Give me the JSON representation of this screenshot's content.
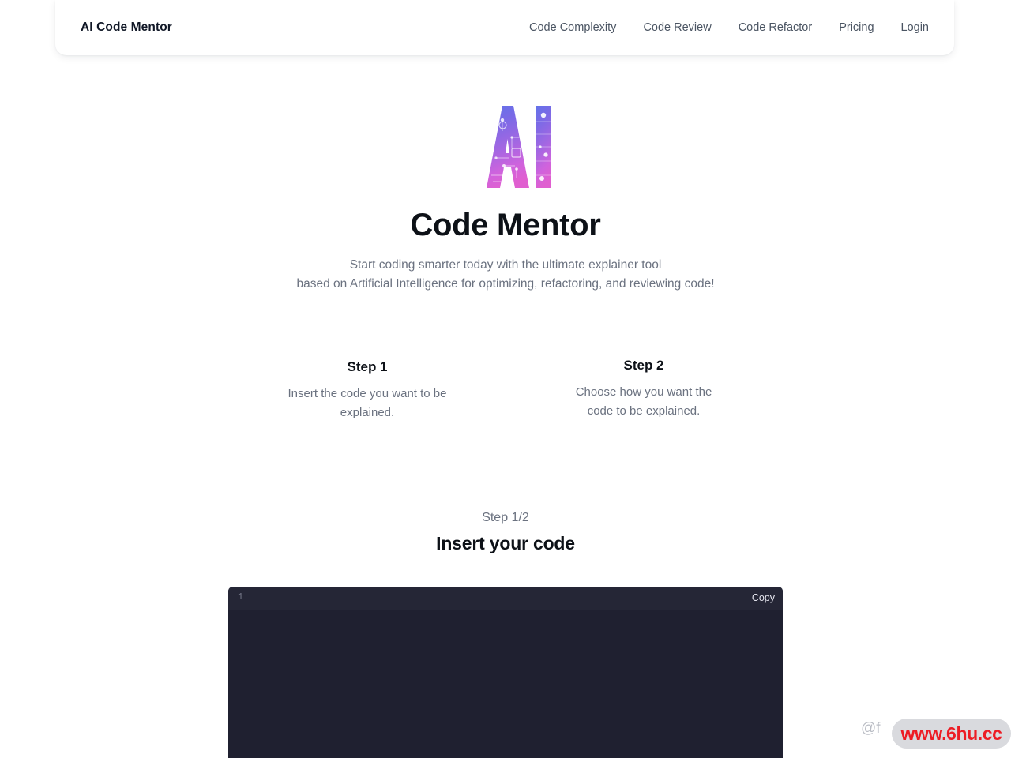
{
  "header": {
    "brand": "AI Code Mentor",
    "nav": [
      {
        "label": "Code Complexity",
        "name": "nav-code-complexity"
      },
      {
        "label": "Code Review",
        "name": "nav-code-review"
      },
      {
        "label": "Code Refactor",
        "name": "nav-code-refactor"
      },
      {
        "label": "Pricing",
        "name": "nav-pricing"
      },
      {
        "label": "Login",
        "name": "nav-login"
      }
    ]
  },
  "hero": {
    "logo_text": "AI",
    "logo_alt": "ai-circuit-logo",
    "title": "Code Mentor",
    "subtitle_line1": "Start coding smarter today with the ultimate explainer tool",
    "subtitle_line2": "based on Artificial Intelligence for optimizing, refactoring, and reviewing code!"
  },
  "steps": [
    {
      "title": "Step 1",
      "desc_line1": "Insert the code you want to be",
      "desc_line2": "explained."
    },
    {
      "title": "Step 2",
      "desc_line1": "Choose how you want the",
      "desc_line2": "code to be explained."
    }
  ],
  "editor_section": {
    "step_counter": "Step 1/2",
    "heading": "Insert your code",
    "line_number": "1",
    "copy_label": "Copy",
    "code_value": "",
    "code_placeholder": ""
  },
  "watermark": {
    "handle": "@f",
    "badge_text": "www.6hu.cc"
  },
  "colors": {
    "accent_blue": "#6b6fe0",
    "accent_purple": "#9b6be0",
    "accent_pink": "#d96be0",
    "editor_bg": "#1f2030",
    "editor_topbar": "#252636",
    "text_primary": "#0d1117",
    "text_muted": "#6b7280",
    "watermark_red": "#ed1c24"
  }
}
